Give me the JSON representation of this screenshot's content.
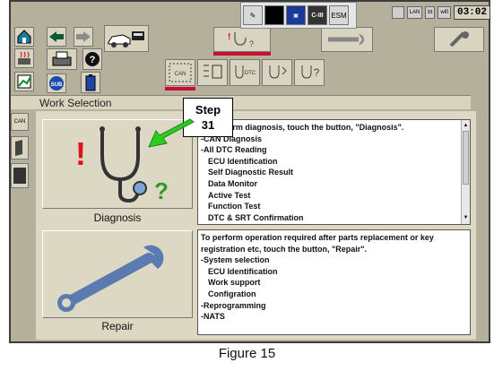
{
  "taskbar": {
    "icons": [
      "pen-icon",
      "black-square-icon",
      "screen-icon",
      "C-III",
      "ESM"
    ]
  },
  "status": {
    "icons": [
      "LAN",
      "bt",
      "wifi"
    ],
    "clock": "03:02"
  },
  "header": {
    "title": "Work Selection"
  },
  "callout": {
    "line1": "Step",
    "line2": "31"
  },
  "diagnosis": {
    "label": "Diagnosis",
    "lines": [
      {
        "text": "To perform diagnosis, touch the button, \"Diagnosis\".",
        "indent": false
      },
      {
        "text": "-CAN Diagnosis",
        "indent": false
      },
      {
        "text": "-All DTC Reading",
        "indent": false
      },
      {
        "text": "ECU Identification",
        "indent": true
      },
      {
        "text": "Self Diagnostic Result",
        "indent": true
      },
      {
        "text": "Data Monitor",
        "indent": true
      },
      {
        "text": "Active Test",
        "indent": true
      },
      {
        "text": "Function Test",
        "indent": true
      },
      {
        "text": "DTC & SRT Confirmation",
        "indent": true
      }
    ]
  },
  "repair": {
    "label": "Repair",
    "lines": [
      {
        "text": "To perform operation required after parts replacement or key",
        "indent": false
      },
      {
        "text": "registration etc, touch the button, \"Repair\".",
        "indent": false
      },
      {
        "text": "-System selection",
        "indent": false
      },
      {
        "text": "ECU Identification",
        "indent": true
      },
      {
        "text": "Work support",
        "indent": true
      },
      {
        "text": "Configration",
        "indent": true
      },
      {
        "text": "-Reprogramming",
        "indent": false
      },
      {
        "text": "-NATS",
        "indent": false
      }
    ]
  },
  "side_labels": {
    "can": "CAN"
  },
  "toolbar_labels": {
    "sub": "SUB",
    "can": "CAN",
    "dtc": "DTC"
  },
  "caption": "Figure 15",
  "colors": {
    "accent_red": "#c8102e",
    "arrow_green": "#2ecc22",
    "background": "#b4b09c"
  }
}
